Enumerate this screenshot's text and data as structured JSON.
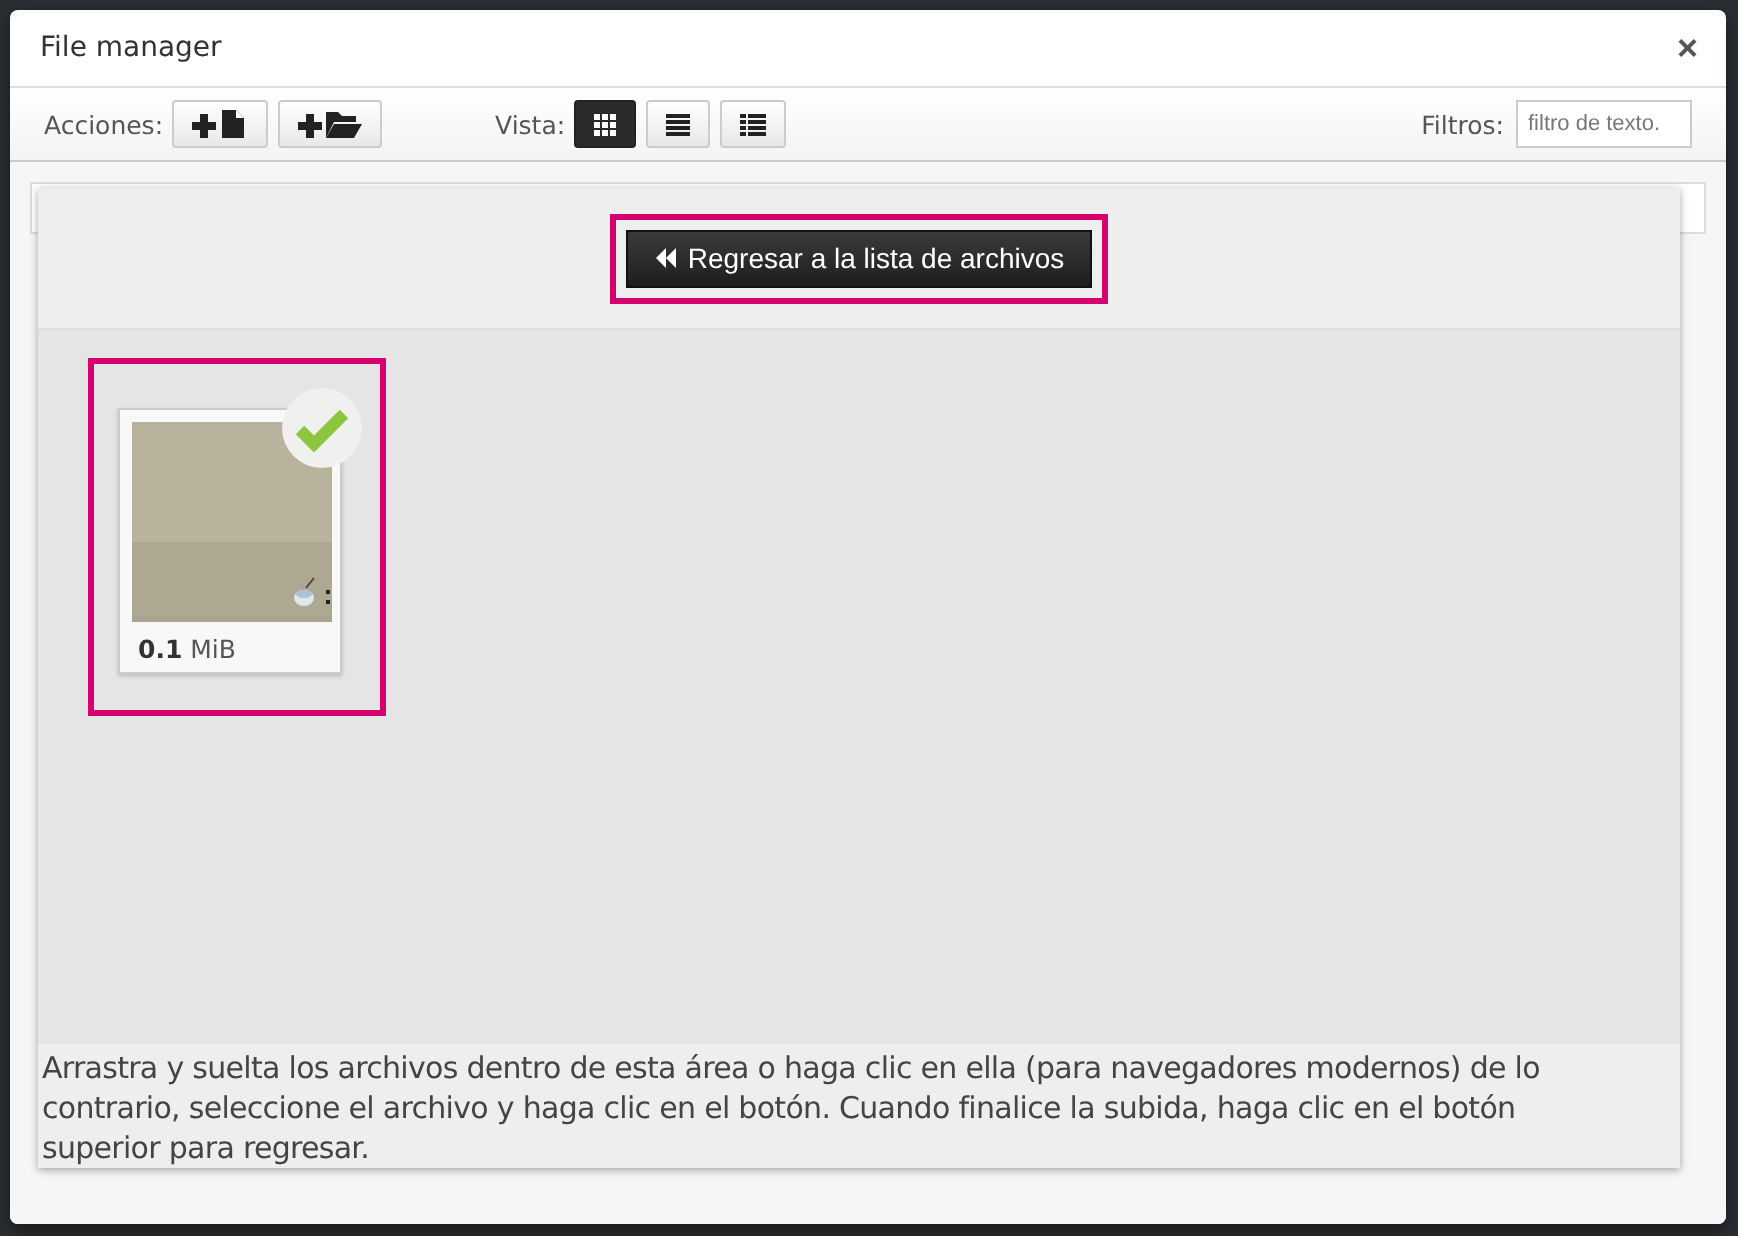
{
  "window": {
    "title": "File manager",
    "close": "×"
  },
  "toolbar": {
    "actions_label": "Acciones:",
    "view_label": "Vista:",
    "filter_label": "Filtros:",
    "filter": {
      "placeholder": "filtro de texto."
    },
    "actions": [
      {
        "kind": "new-file"
      },
      {
        "kind": "new-folder"
      }
    ],
    "views": [
      {
        "kind": "grid",
        "selected": true
      },
      {
        "kind": "list",
        "selected": false
      },
      {
        "kind": "columns",
        "selected": false
      }
    ]
  },
  "back_button": {
    "label": "Regresar a la lista de archivos",
    "highlighted": true
  },
  "files": [
    {
      "size_value": "0.1",
      "size_unit": "MiB",
      "uploaded": true,
      "highlighted": true
    }
  ],
  "instructions": "Arrastra y suelta los archivos dentro de esta área o haga clic en ella (para navegadores modernos) de lo contrario, seleccione el archivo y haga clic en el botón. Cuando finalice la subida, haga clic en el botón superior para regresar."
}
